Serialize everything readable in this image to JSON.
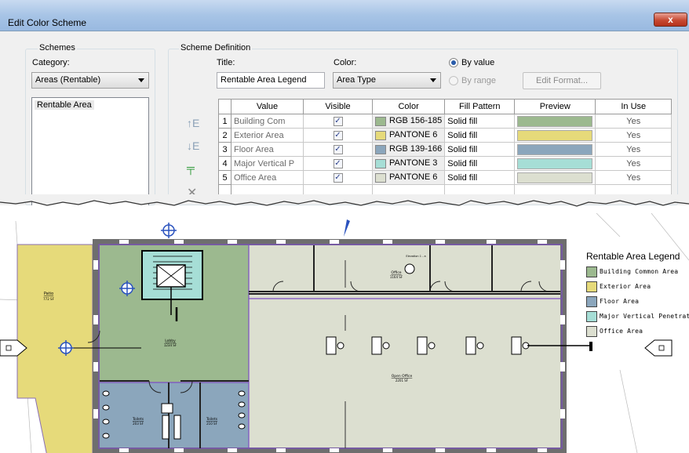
{
  "dialog": {
    "title": "Edit Color Scheme",
    "close_label": "x"
  },
  "schemes": {
    "group_title": "Schemes",
    "category_label": "Category:",
    "category_value": "Areas (Rentable)",
    "list": [
      "Rentable Area"
    ]
  },
  "scheme_definition": {
    "group_title": "Scheme Definition",
    "title_label": "Title:",
    "title_value": "Rentable Area Legend",
    "color_label": "Color:",
    "color_value": "Area Type",
    "by_value_label": "By value",
    "by_range_label": "By range",
    "by_value_selected": true,
    "edit_format_label": "Edit Format...",
    "columns": [
      "Value",
      "Visible",
      "Color",
      "Fill Pattern",
      "Preview",
      "In Use"
    ],
    "rows": [
      {
        "num": "1",
        "value": "Building Com",
        "visible": true,
        "color": "RGB 156-185",
        "swatch": "#9cb98f",
        "fill": "Solid fill",
        "in_use": "Yes"
      },
      {
        "num": "2",
        "value": "Exterior Area",
        "visible": true,
        "color": "PANTONE 6",
        "swatch": "#e6da7a",
        "fill": "Solid fill",
        "in_use": "Yes"
      },
      {
        "num": "3",
        "value": "Floor Area",
        "visible": true,
        "color": "RGB 139-166",
        "swatch": "#8ba6bc",
        "fill": "Solid fill",
        "in_use": "Yes"
      },
      {
        "num": "4",
        "value": "Major Vertical P",
        "visible": true,
        "color": "PANTONE 3",
        "swatch": "#a6ded6",
        "fill": "Solid fill",
        "in_use": "Yes"
      },
      {
        "num": "5",
        "value": "Office Area",
        "visible": true,
        "color": "PANTONE 6",
        "swatch": "#dcdfd0",
        "fill": "Solid fill",
        "in_use": "Yes"
      }
    ]
  },
  "plan": {
    "legend_title": "Rentable Area Legend",
    "legend": [
      {
        "label": "Building Common Area",
        "color": "#9cb98f"
      },
      {
        "label": "Exterior Area",
        "color": "#e6da7a"
      },
      {
        "label": "Floor Area",
        "color": "#8ba6bc"
      },
      {
        "label": "Major Vertical Penetration",
        "color": "#a6ded6"
      },
      {
        "label": "Office Area",
        "color": "#dcdfd0"
      }
    ],
    "room_labels": {
      "patio": "Patio",
      "patio_area": "772 SF",
      "office": "Office",
      "office_area": "1164 SF",
      "elevation_tag": "Elevation 1 - a",
      "lobby": "Lobby",
      "lobby_area": "1234 SF",
      "open_office": "Open Office",
      "open_office_area": "2201 SF",
      "toilets_1": "Toilets",
      "toilets_1_area": "203 SF",
      "toilets_2": "Toilets",
      "toilets_2_area": "210 SF"
    }
  }
}
